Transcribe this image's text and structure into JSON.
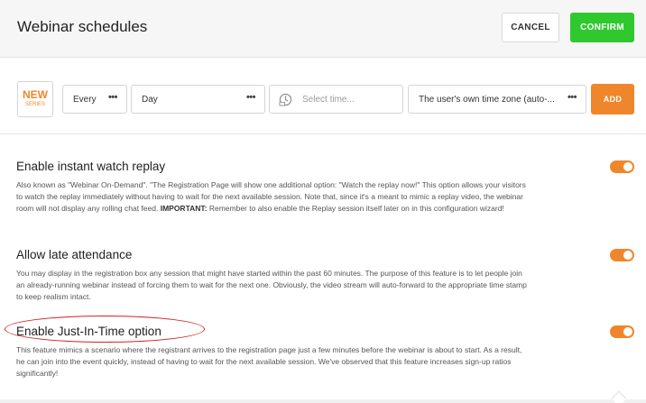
{
  "header": {
    "title": "Webinar schedules",
    "cancel_label": "CANCEL",
    "confirm_label": "CONFIRM",
    "confirm_color": "#2fc82f"
  },
  "schedule": {
    "badge_top": "NEW",
    "badge_bottom": "SERIES",
    "every_value": "Every",
    "day_value": "Day",
    "time_placeholder": "Select time...",
    "timezone_value": "The user's own time zone (auto-...",
    "dots": "•••",
    "add_label": "ADD",
    "accent_color": "#f0862b",
    "icons": [
      "clock-icon",
      "more-dots-icon"
    ]
  },
  "options": [
    {
      "title": "Enable instant watch replay",
      "desc_pre": "Also known as \"Webinar On-Demand\". \"The Registration Page will show one additional option: \"Watch the replay now!\" This option allows your visitors to watch the replay immediately without having to wait for the next available session. Note that, since it's a meant to mimic a replay video, the webinar room will not display any rolling chat feed. ",
      "desc_strong": "IMPORTANT:",
      "desc_post": " Remember to also enable the Replay session itself later on in this configuration wizard!",
      "enabled": true
    },
    {
      "title": "Allow late attendance",
      "desc": "You may display in the registration box any session that might have started within the past 60 minutes. The purpose of this feature is to let people join an already-running webinar instead of forcing them to wait for the next one. Obviously, the video stream will auto-forward to the appropriate time stamp to keep realism intact.",
      "enabled": true
    },
    {
      "title": "Enable Just-In-Time option",
      "desc": "This feature mimics a scenario where the registrant arrives to the registration page just a few minutes before the webinar is about to start. As a result, he can join into the event quickly, instead of having to wait for the next available session. We've observed that this feature increases sign-up ratios significantly!",
      "enabled": true
    }
  ]
}
